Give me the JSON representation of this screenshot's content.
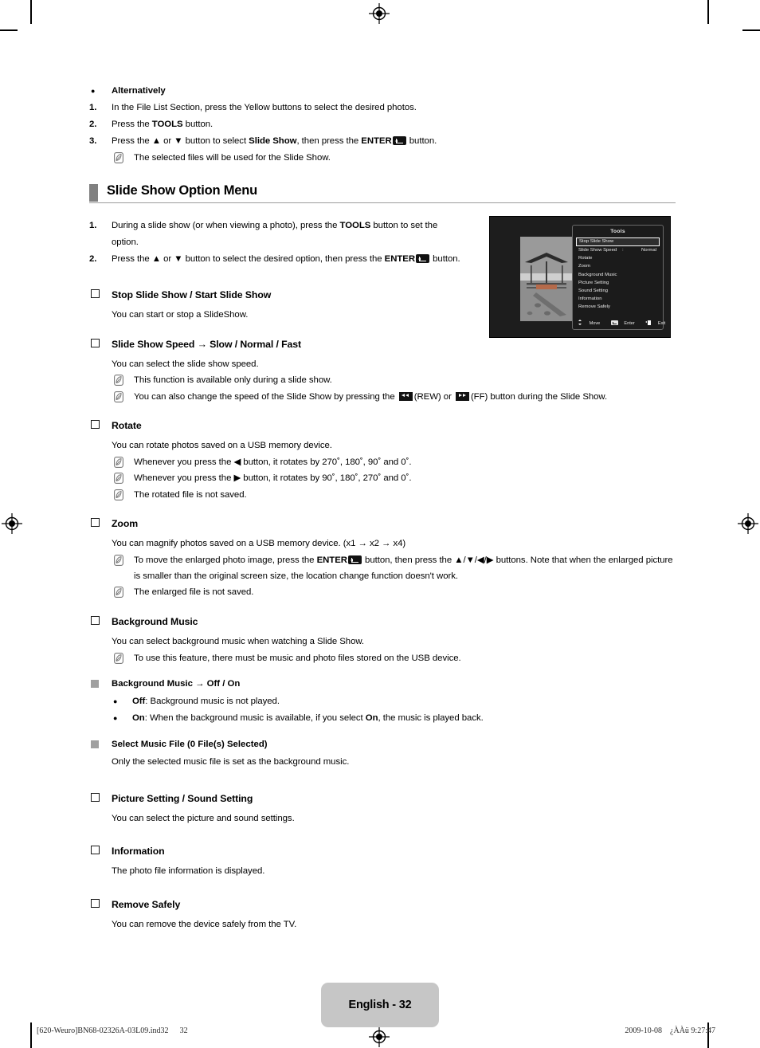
{
  "intro": {
    "alternatively_label": "Alternatively",
    "steps": [
      {
        "num": "1.",
        "text_before": "In the File List Section, press the Yellow buttons to select the desired photos."
      },
      {
        "num": "2.",
        "text_before": "Press the ",
        "bold1": "TOOLS",
        "text_after": " button."
      },
      {
        "num": "3.",
        "text_before": "Press the ▲ or ▼ button to select ",
        "bold1": "Slide Show",
        "text_mid": ", then press the ",
        "bold2": "ENTER",
        "text_after": " button."
      }
    ],
    "note": "The selected files will be used for the Slide Show."
  },
  "section": {
    "title": "Slide Show Option Menu",
    "steps": [
      {
        "num": "1.",
        "text_before": "During a slide show (or when viewing a photo), press the ",
        "bold1": "TOOLS",
        "text_after": " button to set the option."
      },
      {
        "num": "2.",
        "text_before": "Press the ▲ or ▼ button to select the desired option, then press the ",
        "bold1": "ENTER",
        "text_after": " button."
      }
    ]
  },
  "figure": {
    "osd_title": "Tools",
    "menu_items": [
      {
        "label": "Stop Slide Show",
        "selected": true
      },
      {
        "label": "Slide Show Speed",
        "colon": ":",
        "value": "Normal"
      },
      {
        "label": "Rotate"
      },
      {
        "label": "Zoom"
      },
      {
        "label": "Background Music"
      },
      {
        "label": "Picture Setting"
      },
      {
        "label": "Sound Setting"
      },
      {
        "label": "Information"
      },
      {
        "label": "Remove Safely"
      }
    ],
    "footer": {
      "move": "Move",
      "enter": "Enter",
      "exit": "Exit"
    }
  },
  "options": [
    {
      "heading": "Stop Slide Show / Start Slide Show",
      "body": "You can start or stop a SlideShow."
    },
    {
      "heading": "Slide Show Speed → Slow / Normal / Fast",
      "body": "You can select the slide show speed.",
      "notes": [
        {
          "text": "This function is available only during a slide show."
        },
        {
          "text_a": "You can also change the speed of the Slide Show by pressing the ",
          "rew_label": "(REW)",
          "text_b": " or ",
          "ff_label": "(FF)",
          "text_c": " button during the Slide Show."
        }
      ]
    },
    {
      "heading": "Rotate",
      "body": "You can rotate photos saved on a USB memory device.",
      "notes": [
        {
          "text": "Whenever you press the ◀ button, it rotates by 270˚, 180˚, 90˚ and 0˚."
        },
        {
          "text": "Whenever you press the ▶ button, it rotates by 90˚, 180˚, 270˚ and 0˚."
        },
        {
          "text": "The rotated file is not saved."
        }
      ]
    },
    {
      "heading": "Zoom",
      "body": "You can magnify photos saved on a USB memory device. (x1 → x2 → x4)",
      "notes": [
        {
          "text_a": "To move the enlarged photo image, press the ",
          "bold": "ENTER",
          "text_b": " button, then press the ▲/▼/◀/▶ buttons. Note that when the enlarged picture is smaller than the original screen size, the location change function doesn't work."
        },
        {
          "text": "The enlarged file is not saved."
        }
      ]
    },
    {
      "heading": "Background Music",
      "body": "You can select background music when watching a Slide Show.",
      "notes": [
        {
          "text": "To use this feature, there must be music and photo files stored on the USB device."
        }
      ],
      "subs": [
        {
          "heading": "Background Music → Off / On",
          "bullets": [
            {
              "bold": "Off",
              "text": ": Background music is not played."
            },
            {
              "bold": "On",
              "text_a": ": When the background music is available, if you select ",
              "bold2": "On",
              "text_b": ", the music is played back."
            }
          ]
        },
        {
          "heading": "Select Music File (0 File(s) Selected)",
          "body": "Only the selected music file is set as the background music."
        }
      ]
    },
    {
      "heading": "Picture Setting / Sound Setting",
      "body": "You can select the picture and sound settings."
    },
    {
      "heading": "Information",
      "body": "The photo file information is displayed."
    },
    {
      "heading": "Remove Safely",
      "body": "You can remove the device safely from the TV."
    }
  ],
  "footer": {
    "page_badge": "English - 32",
    "file_id": "[620-Weuro]BN68-02326A-03L09.ind32",
    "page_num": "32",
    "date": "2009-10-08",
    "time": "¿ÀÀü 9:27:47"
  }
}
